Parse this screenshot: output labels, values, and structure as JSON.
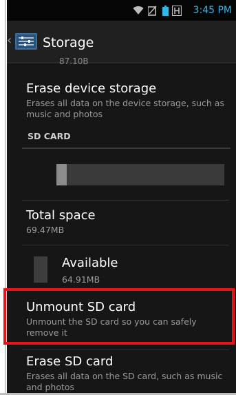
{
  "status_bar": {
    "time": "3:45 PM",
    "icons": [
      "wifi-icon",
      "no-signal-icon",
      "battery-icon",
      "notification-icon"
    ],
    "accent_color": "#33b5e5"
  },
  "action_bar": {
    "up_icon": "chevron-left-icon",
    "app_icon": "settings-sliders-icon",
    "title": "Storage"
  },
  "storage": {
    "erase_device": {
      "title": "Erase device storage",
      "summary": "Erases all data on the device storage, such as music and photos"
    },
    "sd_card_header": "SD CARD",
    "usage_fraction": 0.06,
    "total_space": {
      "title": "Total space",
      "value": "69.47MB"
    },
    "available": {
      "title": "Available",
      "value": "64.91MB"
    },
    "unmount": {
      "title": "Unmount SD card",
      "summary": "Unmount the SD card so you can safely remove it"
    },
    "erase_sd": {
      "title": "Erase SD card",
      "summary": "Erases all data on the SD card, such as music and photos"
    }
  },
  "highlight_color": "#e8141b"
}
